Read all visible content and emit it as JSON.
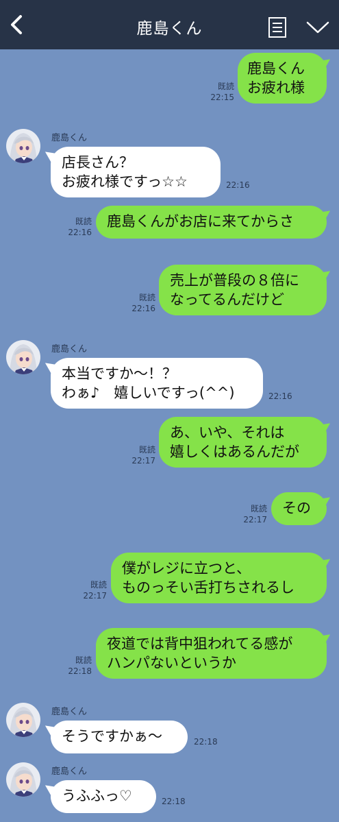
{
  "header": {
    "title": "鹿島くん"
  },
  "contact": {
    "name": "鹿島くん"
  },
  "read_label": "既読",
  "messages": [
    {
      "id": "m1",
      "dir": "out",
      "lines": [
        "鹿島くん",
        "お疲れ様"
      ],
      "time": "22:15",
      "read": "既読"
    },
    {
      "id": "m2",
      "dir": "in",
      "sender": "鹿島くん",
      "lines": [
        "店長さん？",
        "お疲れ様ですっ☆☆"
      ],
      "time": "22:16"
    },
    {
      "id": "m3",
      "dir": "out",
      "lines": [
        "鹿島くんがお店に来てからさ"
      ],
      "time": "22:16",
      "read": "既読"
    },
    {
      "id": "m4",
      "dir": "out",
      "lines": [
        "売上が普段の８倍に",
        "なってるんだけど"
      ],
      "time": "22:16",
      "read": "既読"
    },
    {
      "id": "m5",
      "dir": "in",
      "sender": "鹿島くん",
      "lines": [
        "本当ですか〜！？",
        "わぁ♪　嬉しいですっ(^^)"
      ],
      "time": "22:16"
    },
    {
      "id": "m6",
      "dir": "out",
      "lines": [
        "あ、いや、それは",
        "嬉しくはあるんだが"
      ],
      "time": "22:17",
      "read": "既読"
    },
    {
      "id": "m7",
      "dir": "out",
      "lines": [
        "その"
      ],
      "time": "22:17",
      "read": "既読"
    },
    {
      "id": "m8",
      "dir": "out",
      "lines": [
        "僕がレジに立つと、",
        "ものっそい舌打ちされるし"
      ],
      "time": "22:17",
      "read": "既読"
    },
    {
      "id": "m9",
      "dir": "out",
      "lines": [
        "夜道では背中狙われてる感が",
        "ハンパないというか"
      ],
      "time": "22:18",
      "read": "既読"
    },
    {
      "id": "m10",
      "dir": "in",
      "sender": "鹿島くん",
      "lines": [
        "そうですかぁ〜"
      ],
      "time": "22:18"
    },
    {
      "id": "m11",
      "dir": "in",
      "sender": "鹿島くん",
      "lines": [
        "うふふっ♡"
      ],
      "time": "22:18"
    }
  ],
  "colors": {
    "background": "#7392c1",
    "header": "#273347",
    "outgoing_bubble": "#85e249",
    "incoming_bubble": "#ffffff"
  },
  "icons": [
    "chevron-left-icon",
    "menu-icon",
    "chevron-down-icon",
    "avatar-icon"
  ]
}
